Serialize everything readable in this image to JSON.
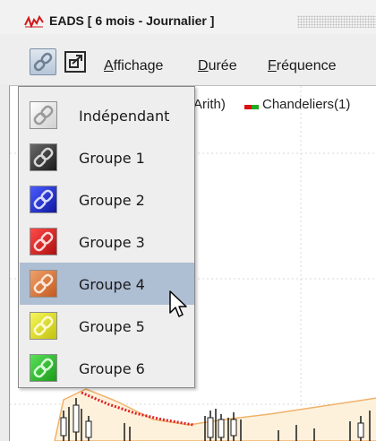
{
  "window": {
    "title": "EADS  [ 6 mois - Journalier ]"
  },
  "toolbar": {
    "menu": [
      {
        "label_mnemonic": "A",
        "label_rest": "ffichage"
      },
      {
        "label_mnemonic": "D",
        "label_rest": "urée"
      },
      {
        "label_mnemonic": "F",
        "label_rest": "réquence"
      }
    ]
  },
  "chart": {
    "legend_left": "Arith)",
    "legend_right": "Chandeliers(1)",
    "legend_colors": [
      "#dd1111",
      "#22aa22"
    ]
  },
  "link_menu": {
    "items": [
      {
        "label": "Indépendant",
        "color": "#f4f4f4",
        "icon": "link-icon-white"
      },
      {
        "label": "Groupe 1",
        "color": "#3a3a3a",
        "icon": "link-icon-black"
      },
      {
        "label": "Groupe 2",
        "color": "#2330d8",
        "icon": "link-icon-blue"
      },
      {
        "label": "Groupe 3",
        "color": "#dd2222",
        "icon": "link-icon-red"
      },
      {
        "label": "Groupe 4",
        "color": "#e07a3a",
        "icon": "link-icon-orange",
        "selected": true
      },
      {
        "label": "Groupe 5",
        "color": "#e3e31f",
        "icon": "link-icon-yellow"
      },
      {
        "label": "Groupe 6",
        "color": "#2ec03a",
        "icon": "link-icon-green"
      }
    ]
  }
}
